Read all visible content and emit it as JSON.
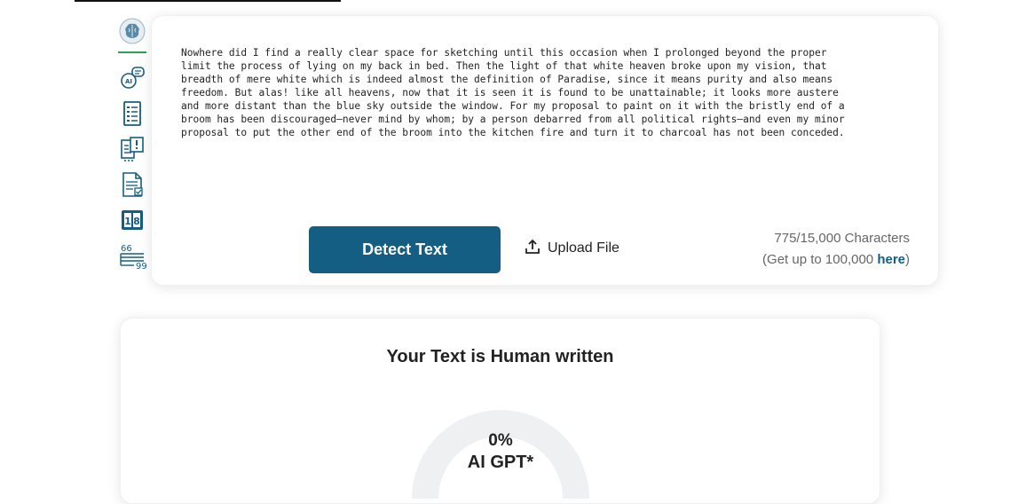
{
  "editor": {
    "text": "Nowhere did I find a really clear space for sketching until this occasion when I prolonged beyond the proper\nlimit the process of lying on my back in bed. Then the light of that white heaven broke upon my vision, that\nbreadth of mere white which is indeed almost the definition of Paradise, since it means purity and also means\nfreedom. But alas! like all heavens, now that it is seen it is found to be unattainable; it looks more austere\nand more distant than the blue sky outside the window. For my proposal to paint on it with the bristly end of a\nbroom has been discouraged—never mind by whom; by a person debarred from all political rights—and even my minor\nproposal to put the other end of the broom into the kitchen fire and turn it to charcoal has not been conceded."
  },
  "actions": {
    "detect_label": "Detect Text",
    "upload_label": "Upload File"
  },
  "char_count": {
    "count_text": "775/15,000 Characters",
    "upgrade_prefix": "(Get up to 100,000 ",
    "upgrade_link": "here",
    "upgrade_suffix": ")"
  },
  "result": {
    "title": "Your Text is Human written",
    "ai_percent": "0%",
    "ai_label": "AI GPT*",
    "ai_fraction": 0
  },
  "tool_rail": {
    "items": [
      {
        "icon": "brain-logo-icon"
      },
      {
        "icon": "ai-chat-icon"
      },
      {
        "icon": "document-list-icon"
      },
      {
        "icon": "plagiarism-check-icon"
      },
      {
        "icon": "document-check-icon"
      },
      {
        "icon": "word-counter-icon"
      },
      {
        "icon": "quote-icon"
      }
    ]
  },
  "colors": {
    "primary": "#135e82",
    "accent_green": "#2e9c5a",
    "gauge_track": "#eef0f1"
  }
}
